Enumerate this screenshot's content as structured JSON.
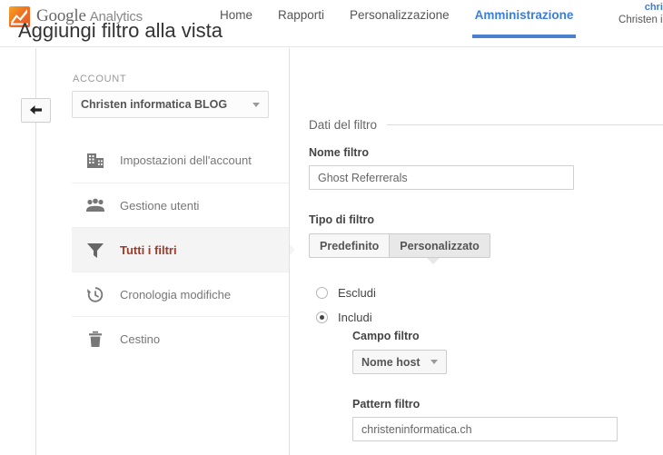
{
  "header": {
    "brand": "Google",
    "brand_sub": "Analytics",
    "logo_icon": "analytics-chart-logo",
    "nav": [
      {
        "label": "Home",
        "active": false
      },
      {
        "label": "Rapporti",
        "active": false
      },
      {
        "label": "Personalizzazione",
        "active": false
      },
      {
        "label": "Amministrazione",
        "active": true
      }
    ],
    "user": {
      "email": "chris",
      "name": "Christen in"
    },
    "accent_color": "#4b7fd0"
  },
  "back_button": {
    "icon": "back-arrow-icon",
    "label": ""
  },
  "sidebar": {
    "account_label": "ACCOUNT",
    "account_value": "Christen informatica BLOG",
    "items": [
      {
        "label": "Impostazioni dell'account",
        "icon": "building-icon",
        "selected": false
      },
      {
        "label": "Gestione utenti",
        "icon": "users-icon",
        "selected": false
      },
      {
        "label": "Tutti i filtri",
        "icon": "funnel-icon",
        "selected": true
      },
      {
        "label": "Cronologia modifiche",
        "icon": "history-clock-icon",
        "selected": false
      },
      {
        "label": "Cestino",
        "icon": "trash-icon",
        "selected": false
      }
    ],
    "selected_color": "#a03b28"
  },
  "main": {
    "title": "Aggiungi filtro alla vista",
    "section_header": "Dati del filtro",
    "name_label": "Nome filtro",
    "name_value": "Ghost Referrerals",
    "name_placeholder": "",
    "type_label": "Tipo di filtro",
    "tabs": [
      {
        "label": "Predefinito",
        "active": false
      },
      {
        "label": "Personalizzato",
        "active": true
      }
    ],
    "radios": [
      {
        "label": "Escludi",
        "checked": false
      },
      {
        "label": "Includi",
        "checked": true
      }
    ],
    "field_label": "Campo filtro",
    "field_value": "Nome host",
    "pattern_label": "Pattern filtro",
    "pattern_value": "christeninformatica.ch",
    "pattern_placeholder": ""
  }
}
